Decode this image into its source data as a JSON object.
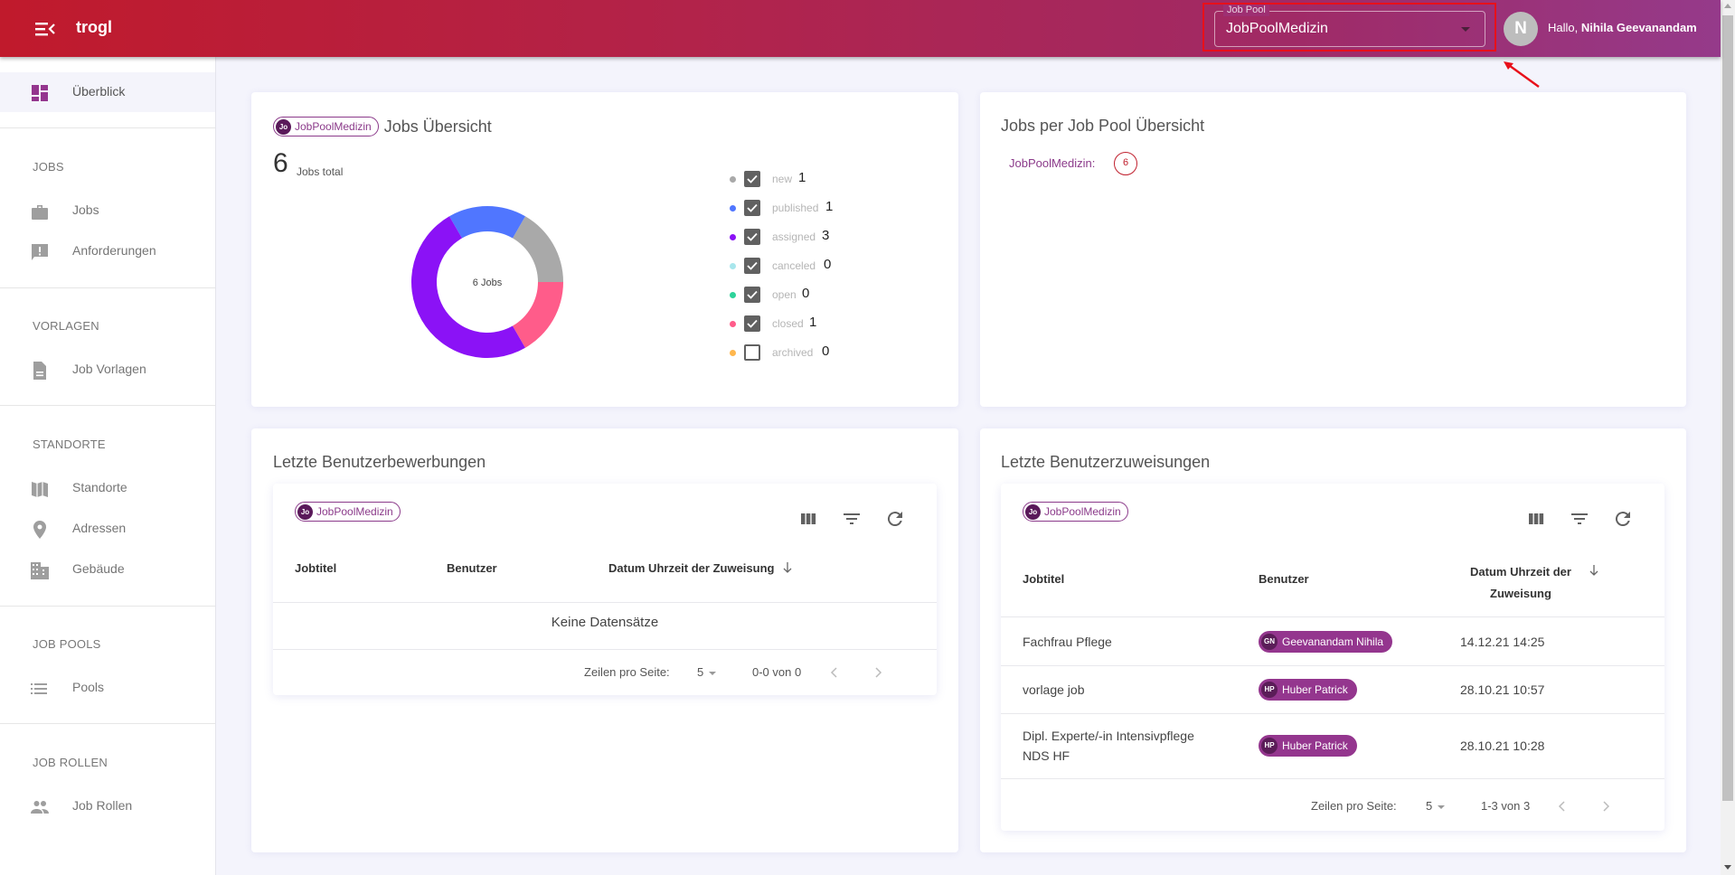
{
  "header": {
    "app_name": "trogl",
    "job_pool_label": "Job Pool",
    "job_pool_value": "JobPoolMedizin",
    "avatar_initial": "N",
    "greeting_prefix": "Hallo, ",
    "user_name": "Nihila Geevanandam"
  },
  "sidebar": {
    "overview": "Überblick",
    "sections": [
      {
        "label": "JOBS",
        "items": [
          "Jobs",
          "Anforderungen"
        ]
      },
      {
        "label": "VORLAGEN",
        "items": [
          "Job Vorlagen"
        ]
      },
      {
        "label": "STANDORTE",
        "items": [
          "Standorte",
          "Adressen",
          "Gebäude"
        ]
      },
      {
        "label": "JOB POOLS",
        "items": [
          "Pools"
        ]
      },
      {
        "label": "JOB ROLLEN",
        "items": [
          "Job Rollen"
        ]
      }
    ]
  },
  "jobs_overview": {
    "chip_avatar": "Jo",
    "chip_label": "JobPoolMedizin",
    "title": "Jobs Übersicht",
    "total": "6",
    "total_label": "Jobs total",
    "center_label": "6 Jobs"
  },
  "chart_data": {
    "type": "pie",
    "title": "Jobs Übersicht",
    "center_label": "6 Jobs",
    "total": 6,
    "categories": [
      "new",
      "published",
      "assigned",
      "canceled",
      "open",
      "closed",
      "archived"
    ],
    "values": [
      1,
      1,
      3,
      0,
      0,
      1,
      0
    ],
    "colors": [
      "#a9a9a9",
      "#5076ff",
      "#8b12f6",
      "#a8e6ec",
      "#2ed39a",
      "#ff5c8a",
      "#ffb74d"
    ],
    "checked": [
      true,
      true,
      true,
      true,
      true,
      true,
      false
    ],
    "legend_position": "right"
  },
  "pool_overview": {
    "title": "Jobs per Job Pool Übersicht",
    "pool_label": "JobPoolMedizin:",
    "pool_count": "6"
  },
  "applications": {
    "title": "Letzte Benutzerbewerbungen",
    "chip_avatar": "Jo",
    "chip_label": "JobPoolMedizin",
    "columns": [
      "Jobtitel",
      "Benutzer",
      "Datum Uhrzeit der Zuweisung"
    ],
    "sort_icon": "arrow-down",
    "empty_text": "Keine Datensätze",
    "rows_per_page_label": "Zeilen pro Seite:",
    "rows_per_page": "5",
    "range": "0-0 von 0"
  },
  "assignments": {
    "title": "Letzte Benutzerzuweisungen",
    "chip_avatar": "Jo",
    "chip_label": "JobPoolMedizin",
    "columns": [
      "Jobtitel",
      "Benutzer",
      "Datum Uhrzeit der Zuweisung"
    ],
    "rows": [
      {
        "job": "Fachfrau Pflege",
        "user_initials": "GN",
        "user": "Geevanandam Nihila",
        "date": "14.12.21 14:25"
      },
      {
        "job": "vorlage job",
        "user_initials": "HP",
        "user": "Huber Patrick",
        "date": "28.10.21 10:57"
      },
      {
        "job": "Dipl. Experte/-in Intensivpflege NDS HF",
        "user_initials": "HP",
        "user": "Huber Patrick",
        "date": "28.10.21 10:28"
      }
    ],
    "rows_per_page_label": "Zeilen pro Seite:",
    "rows_per_page": "5",
    "range": "1-3 von 3"
  },
  "colors": {
    "accent": "#94368e",
    "header_start": "#c01a2c",
    "header_end": "#953a8a",
    "badge_red": "#c0202e"
  }
}
